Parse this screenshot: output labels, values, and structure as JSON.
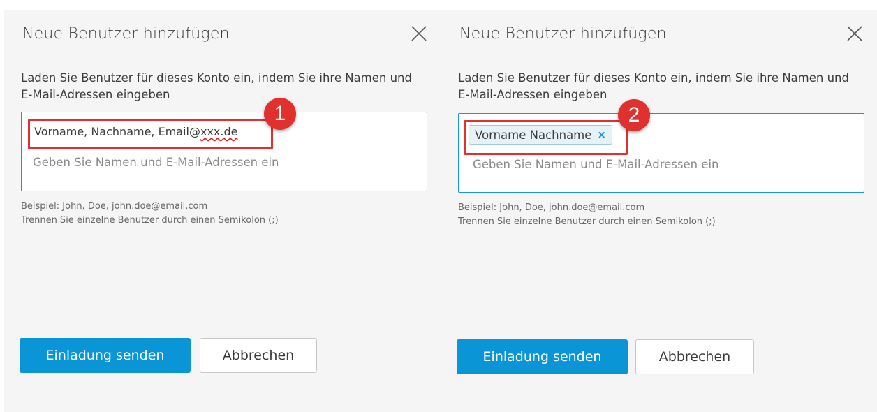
{
  "left": {
    "title": "Neue Benutzer hinzufügen",
    "instructions": "Laden Sie Benutzer für dieses Konto ein, indem Sie ihre Namen und E-Mail-Adressen eingeben",
    "typed_prefix": "Vorname, Nachname, Email@",
    "typed_domain": "xxx.de",
    "placeholder": "Geben Sie Namen und E-Mail-Adressen ein",
    "hint_line1": "Beispiel: John, Doe, john.doe@email.com",
    "hint_line2": "Trennen Sie einzelne Benutzer durch einen Semikolon (;)",
    "primary_button": "Einladung senden",
    "secondary_button": "Abbrechen",
    "step": "1"
  },
  "right": {
    "title": "Neue Benutzer hinzufügen",
    "instructions": "Laden Sie Benutzer für dieses Konto ein, indem Sie ihre Namen und E-Mail-Adressen eingeben",
    "chip_label": "Vorname Nachname",
    "chip_remove": "×",
    "placeholder": "Geben Sie Namen und E-Mail-Adressen ein",
    "hint_line1": "Beispiel: John, Doe, john.doe@email.com",
    "hint_line2": "Trennen Sie einzelne Benutzer durch einen Semikolon (;)",
    "primary_button": "Einladung senden",
    "secondary_button": "Abbrechen",
    "step": "2"
  },
  "icons": {
    "close": "close-icon"
  },
  "colors": {
    "accent": "#0a96d6",
    "annotation": "#e0312f",
    "panel_bg": "#f5f5f5"
  }
}
